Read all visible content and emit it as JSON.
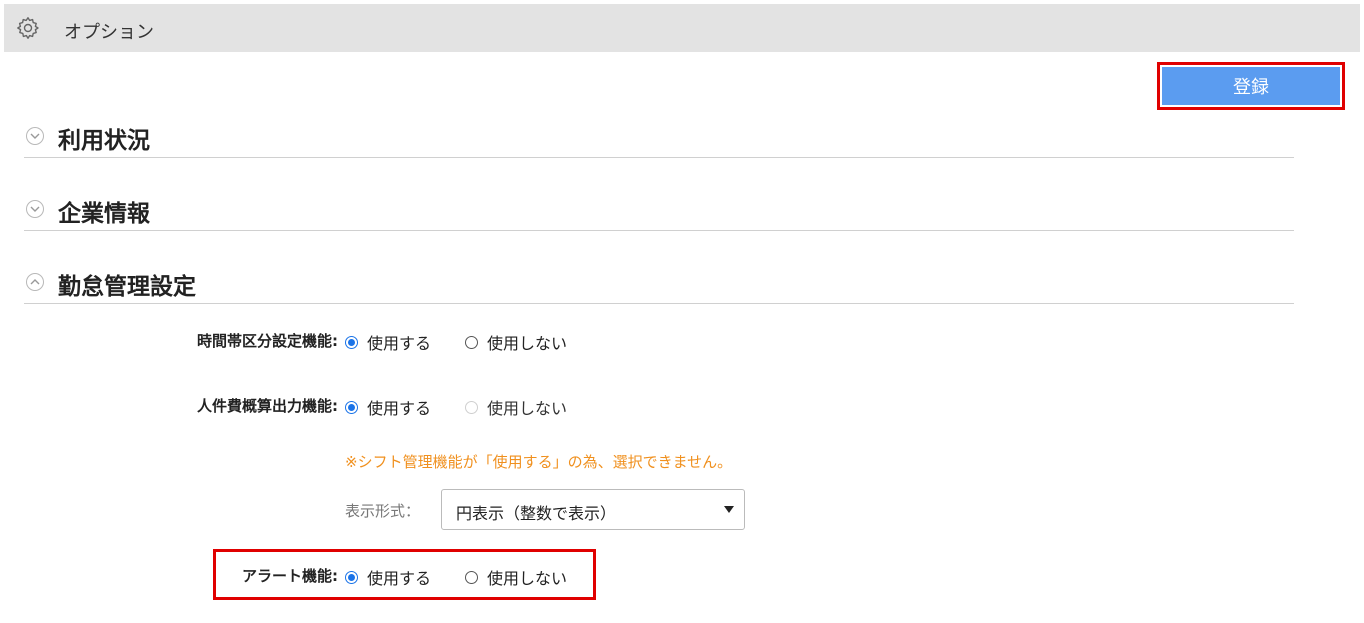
{
  "header": {
    "title": "オプション",
    "icon": "gear-icon"
  },
  "toolbar": {
    "save_label": "登録"
  },
  "sections": [
    {
      "title": "利用状況",
      "expanded": false
    },
    {
      "title": "企業情報",
      "expanded": false
    },
    {
      "title": "勤怠管理設定",
      "expanded": true
    }
  ],
  "settings": {
    "time_zone": {
      "label": "時間帯区分設定機能:",
      "options": [
        "使用する",
        "使用しない"
      ],
      "selected": "使用する"
    },
    "labor_cost": {
      "label": "人件費概算出力機能:",
      "options": [
        "使用する",
        "使用しない"
      ],
      "selected": "使用する",
      "disabled_option": "使用しない",
      "warning": "※シフト管理機能が「使用する」の為、選択できません。",
      "format_label": "表示形式：",
      "format_value": "円表示（整数で表示）"
    },
    "alert": {
      "label": "アラート機能:",
      "options": [
        "使用する",
        "使用しない"
      ],
      "selected": "使用する"
    }
  },
  "colors": {
    "accent": "#5b9cf0",
    "highlight": "#e00000",
    "warning": "#f0901e",
    "radio": "#1a73e8"
  }
}
